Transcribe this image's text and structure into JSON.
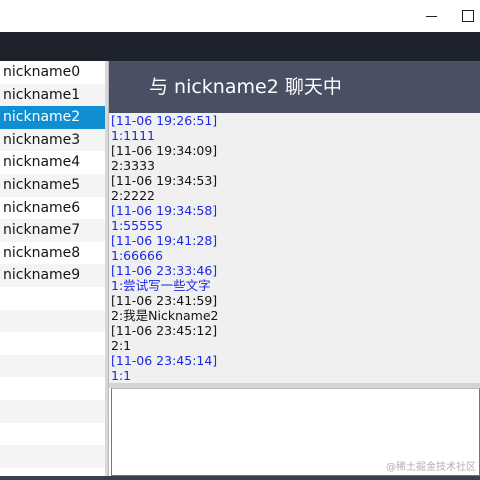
{
  "window": {
    "minimize_glyph": "minimize-icon",
    "maximize_glyph": "maximize-icon"
  },
  "sidebar": {
    "selected_index": 2,
    "items": [
      {
        "label": "nickname0"
      },
      {
        "label": "nickname1"
      },
      {
        "label": "nickname2"
      },
      {
        "label": "nickname3"
      },
      {
        "label": "nickname4"
      },
      {
        "label": "nickname5"
      },
      {
        "label": "nickname6"
      },
      {
        "label": "nickname7"
      },
      {
        "label": "nickname8"
      },
      {
        "label": "nickname9"
      }
    ]
  },
  "chat": {
    "header_title": "与 nickname2 聊天中",
    "messages": [
      {
        "sender": "self",
        "text": "[11-06 19:26:51]1:1111"
      },
      {
        "sender": "other",
        "text": "[11-06 19:34:09]2:3333"
      },
      {
        "sender": "other",
        "text": "[11-06 19:34:53]2:2222"
      },
      {
        "sender": "self",
        "text": "[11-06 19:34:58]1:55555"
      },
      {
        "sender": "self",
        "text": "[11-06 19:41:28]1:66666"
      },
      {
        "sender": "self",
        "text": "[11-06 23:33:46]1:尝试写一些文字"
      },
      {
        "sender": "other",
        "text": "[11-06 23:41:59]2:我是Nickname2"
      },
      {
        "sender": "other",
        "text": "[11-06 23:45:12]2:1"
      },
      {
        "sender": "self",
        "text": "[11-06 23:45:14]1:1"
      }
    ],
    "input_value": ""
  },
  "watermark": "@稀土掘金技术社区",
  "colors": {
    "selected_bg": "#0f8ed2",
    "header_bg": "#4a5064",
    "self_text": "#1a28e8",
    "other_text": "#141414",
    "app_band": "#1e222c"
  }
}
